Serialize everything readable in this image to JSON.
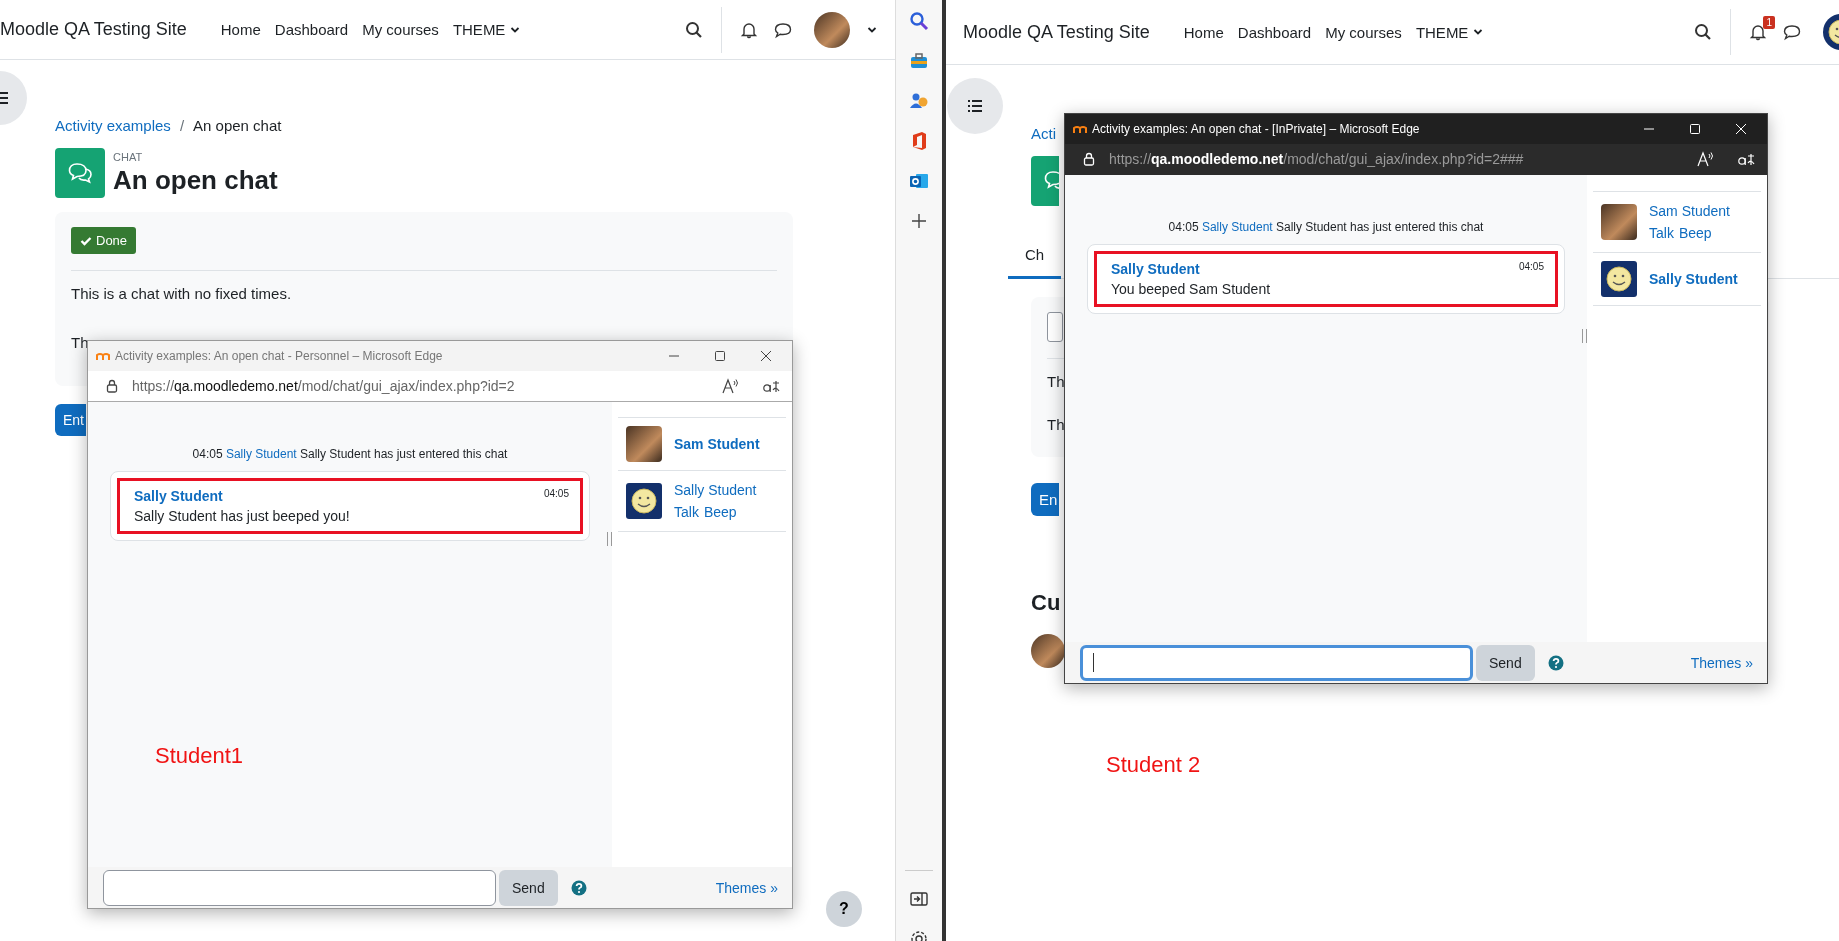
{
  "panes": [
    {
      "site_name": "Moodle QA Testing Site",
      "nav": [
        "Home",
        "Dashboard",
        "My courses",
        "THEME"
      ],
      "nav_avatar": {
        "kind": "photo"
      },
      "page": {
        "breadcrumb": [
          "Activity examples",
          "An open chat"
        ],
        "breadcrumb_separator": "/",
        "module_label": "CHAT",
        "title": "An open chat",
        "completion_button": "Done",
        "description": [
          "This is a chat with no fixed times.",
          "Th"
        ],
        "enter_button": "Ent"
      },
      "popup": {
        "kind": "light",
        "title": "Activity examples: An open chat - Personnel – Microsoft Edge",
        "url_scheme": "https://",
        "url_host": "qa.moodledemo.net",
        "url_path": "/mod/chat/gui_ajax/index.php?id=2",
        "system_message": {
          "time": "04:05",
          "user": "Sally Student",
          "text": "Sally Student has just entered this chat"
        },
        "message": {
          "user": "Sally Student",
          "time": "04:05",
          "text": "Sally Student has just beeped you!"
        },
        "users": [
          {
            "name": "Sam Student",
            "current": true,
            "kind": "photo"
          },
          {
            "name": "Sally Student",
            "current": false,
            "kind": "smiley",
            "actions": [
              "Talk",
              "Beep"
            ]
          }
        ],
        "input_focused": false,
        "send": "Send",
        "themes": "Themes »"
      },
      "caption": "Student1",
      "help_button": "?"
    },
    {
      "site_name": "Moodle QA Testing Site",
      "nav": [
        "Home",
        "Dashboard",
        "My courses",
        "THEME"
      ],
      "notification_badge": "1",
      "nav_avatar": {
        "kind": "smiley"
      },
      "page": {
        "breadcrumb": [
          "Acti"
        ],
        "tab": "Ch",
        "description": [
          "Th",
          "Th"
        ],
        "enter_button": "En",
        "section_heading": "Cu"
      },
      "popup": {
        "kind": "dark",
        "title": "Activity examples: An open chat - [InPrivate] – Microsoft Edge",
        "url_scheme": "https://",
        "url_host": "qa.moodledemo.net",
        "url_path": "/mod/chat/gui_ajax/index.php?id=2###",
        "system_message": {
          "time": "04:05",
          "user": "Sally Student",
          "text": "Sally Student has just entered this chat"
        },
        "message": {
          "user": "Sally Student",
          "time": "04:05",
          "text": "You beeped Sam Student"
        },
        "users": [
          {
            "name": "Sam Student",
            "current": false,
            "kind": "photo",
            "actions": [
              "Talk",
              "Beep"
            ]
          },
          {
            "name": "Sally Student",
            "current": true,
            "kind": "smiley"
          }
        ],
        "input_focused": true,
        "send": "Send",
        "themes": "Themes »"
      },
      "caption": "Student 2"
    }
  ]
}
